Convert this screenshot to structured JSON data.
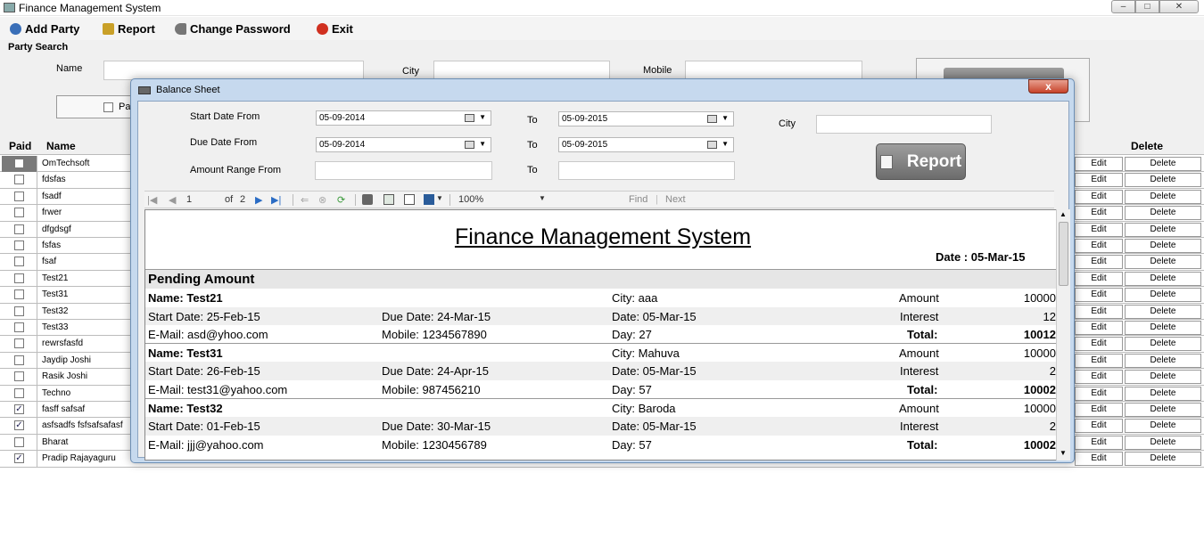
{
  "window": {
    "title": "Finance Management System",
    "min": "–",
    "max": "□",
    "close": "✕"
  },
  "menu": [
    {
      "label": "Add Party",
      "icon": "user-add-icon",
      "color": "#3a6fb8"
    },
    {
      "label": "Report",
      "icon": "report-icon",
      "color": "#c9a028"
    },
    {
      "label": "Change Password",
      "icon": "key-icon",
      "color": "#666666"
    },
    {
      "label": "Exit",
      "icon": "exit-icon",
      "color": "#d03020"
    }
  ],
  "search": {
    "title": "Party Search",
    "name_label": "Name",
    "city_label": "City",
    "mobile_label": "Mobile",
    "paid_label": "Pa"
  },
  "grid": {
    "headers": {
      "paid": "Paid",
      "name": "Name",
      "delete": "Delete"
    },
    "edit_label": "Edit",
    "delete_label": "Delete",
    "rows": [
      {
        "name": "OmTechsoft",
        "paid": false,
        "selected": true
      },
      {
        "name": "fdsfas",
        "paid": false
      },
      {
        "name": "fsadf",
        "paid": false
      },
      {
        "name": "frwer",
        "paid": false
      },
      {
        "name": "dfgdsgf",
        "paid": false
      },
      {
        "name": "fsfas",
        "paid": false
      },
      {
        "name": "fsaf",
        "paid": false
      },
      {
        "name": "Test21",
        "paid": false
      },
      {
        "name": "Test31",
        "paid": false
      },
      {
        "name": "Test32",
        "paid": false
      },
      {
        "name": "Test33",
        "paid": false
      },
      {
        "name": "rewrsfasfd",
        "paid": false
      },
      {
        "name": "Jaydip Joshi",
        "paid": false
      },
      {
        "name": "Rasik Joshi",
        "paid": false
      },
      {
        "name": "Techno",
        "paid": false
      },
      {
        "name": "fasff safsaf",
        "paid": true
      },
      {
        "name": "asfsadfs fsfsafsafasf",
        "paid": true
      },
      {
        "name": "Bharat",
        "paid": false
      },
      {
        "name": "Pradip Rajayaguru",
        "paid": true
      }
    ]
  },
  "dialog": {
    "title": "Balance Sheet",
    "close": "x",
    "start_date_label": "Start Date From",
    "due_date_label": "Due Date From",
    "amount_label": "Amount Range From",
    "to_label": "To",
    "city_label": "City",
    "start_from": "05-09-2014",
    "start_to": "05-09-2015",
    "due_from": "05-09-2014",
    "due_to": "05-09-2015",
    "amount_from": "",
    "amount_to": "",
    "city": "",
    "report_button": "Report"
  },
  "viewer": {
    "page": "1",
    "of": "of",
    "total_pages": "2",
    "zoom": "100%",
    "find": "Find",
    "next": "Next",
    "sep": "|"
  },
  "report": {
    "title": "Finance Management System",
    "date": "Date : 05-Mar-15",
    "section": "Pending Amount",
    "entries": [
      {
        "name": "Name: Test21",
        "city": "City: aaa",
        "amount_label": "Amount",
        "amount": "10000",
        "start": "Start Date: 25-Feb-15",
        "due": "Due Date: 24-Mar-15",
        "date": "Date: 05-Mar-15",
        "interest_label": "Interest",
        "interest": "12",
        "email": "E-Mail: asd@yhoo.com",
        "mobile": "Mobile: 1234567890",
        "day": "Day: 27",
        "total_label": "Total:",
        "total": "10012"
      },
      {
        "name": "Name: Test31",
        "city": "City: Mahuva",
        "amount_label": "Amount",
        "amount": "10000",
        "start": "Start Date: 26-Feb-15",
        "due": "Due Date: 24-Apr-15",
        "date": "Date: 05-Mar-15",
        "interest_label": "Interest",
        "interest": "2",
        "email": "E-Mail: test31@yahoo.com",
        "mobile": "Mobile: 987456210",
        "day": "Day: 57",
        "total_label": "Total:",
        "total": "10002"
      },
      {
        "name": "Name: Test32",
        "city": "City: Baroda",
        "amount_label": "Amount",
        "amount": "10000",
        "start": "Start Date: 01-Feb-15",
        "due": "Due Date: 30-Mar-15",
        "date": "Date: 05-Mar-15",
        "interest_label": "Interest",
        "interest": "2",
        "email": "E-Mail: jjj@yahoo.com",
        "mobile": "Mobile: 1230456789",
        "day": "Day: 57",
        "total_label": "Total:",
        "total": "10002"
      }
    ]
  }
}
